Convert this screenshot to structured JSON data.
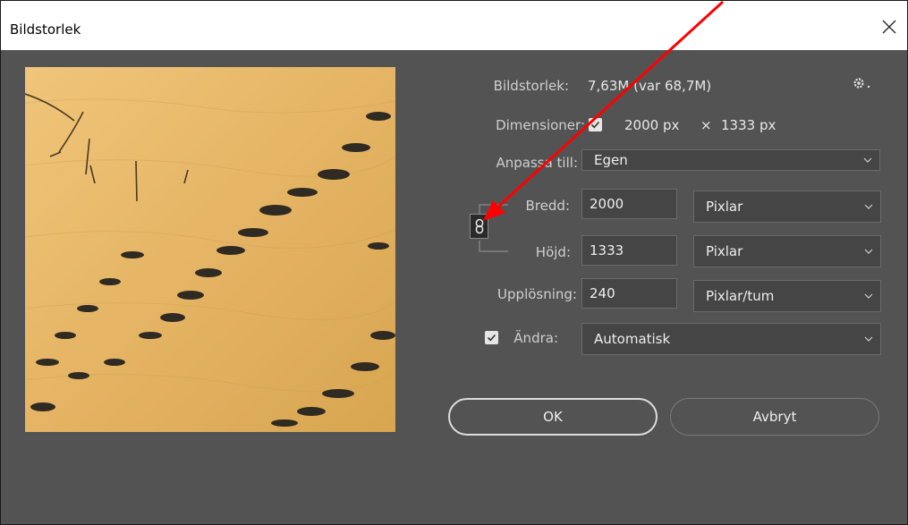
{
  "window": {
    "title": "Bildstorlek"
  },
  "info": {
    "size_label": "Bildstorlek:",
    "size_value": "7,63M (var 68,7M)",
    "dimensions_label": "Dimensioner:",
    "dimensions_width": "2000 px",
    "dimensions_sep": "×",
    "dimensions_height": "1333 px",
    "dimensions_checked": true
  },
  "fit": {
    "label": "Anpassa till:",
    "value": "Egen"
  },
  "width": {
    "label": "Bredd:",
    "value": "2000",
    "unit": "Pixlar"
  },
  "height": {
    "label": "Höjd:",
    "value": "1333",
    "unit": "Pixlar"
  },
  "resolution": {
    "label": "Upplösning:",
    "value": "240",
    "unit": "Pixlar/tum"
  },
  "resample": {
    "label": "Ändra:",
    "checked": true,
    "value": "Automatisk"
  },
  "buttons": {
    "ok": "OK",
    "cancel": "Avbryt"
  },
  "icons": {
    "close": "close-icon",
    "settings": "gear-icon",
    "constrain": "chain-link-icon",
    "annotation": "red-arrow"
  },
  "colors": {
    "dialog_bg": "#535353",
    "field_bg": "#454545",
    "annotation_arrow": "#ff0000",
    "sand": "#e7b869"
  }
}
